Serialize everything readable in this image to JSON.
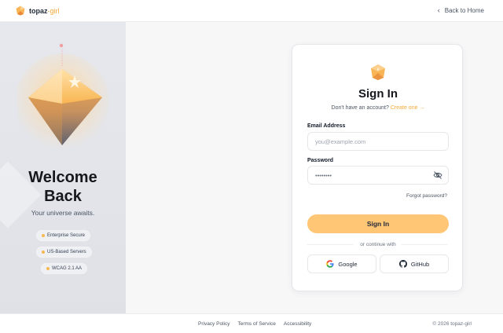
{
  "header": {
    "brand_name": "topaz",
    "brand_suffix": "-girl",
    "back_link": "Back to Home"
  },
  "hero": {
    "headline_line1": "Welcome",
    "headline_line2": "Back",
    "tagline": "Your universe awaits.",
    "badges": [
      "Enterprise Secure",
      "US-Based Servers",
      "WCAG 2.1 AA"
    ]
  },
  "form": {
    "title": "Sign In",
    "subtitle": "Don't have an account?",
    "create_link": "Create one →",
    "email_label": "Email Address",
    "email_placeholder": "you@example.com",
    "password_label": "Password",
    "password_value": "••••••••",
    "forgot_link": "Forgot password?",
    "submit_label": "Sign In",
    "divider_text": "or continue with",
    "google_label": "Google",
    "github_label": "GitHub"
  },
  "footer": {
    "links": [
      "Privacy Policy",
      "Terms of Service",
      "Accessibility"
    ],
    "copyright": "© 2026 topaz-girl"
  },
  "icons": {
    "back": "chevron-left-icon",
    "password_toggle": "eye-off-icon",
    "google": "google-icon",
    "github": "github-icon",
    "logo": "topaz-gem-icon"
  },
  "colors": {
    "accent": "#f3a93a",
    "button": "#fec675",
    "badge_dot": "#f6b94f",
    "panel_bg": "#e3e5eb"
  }
}
